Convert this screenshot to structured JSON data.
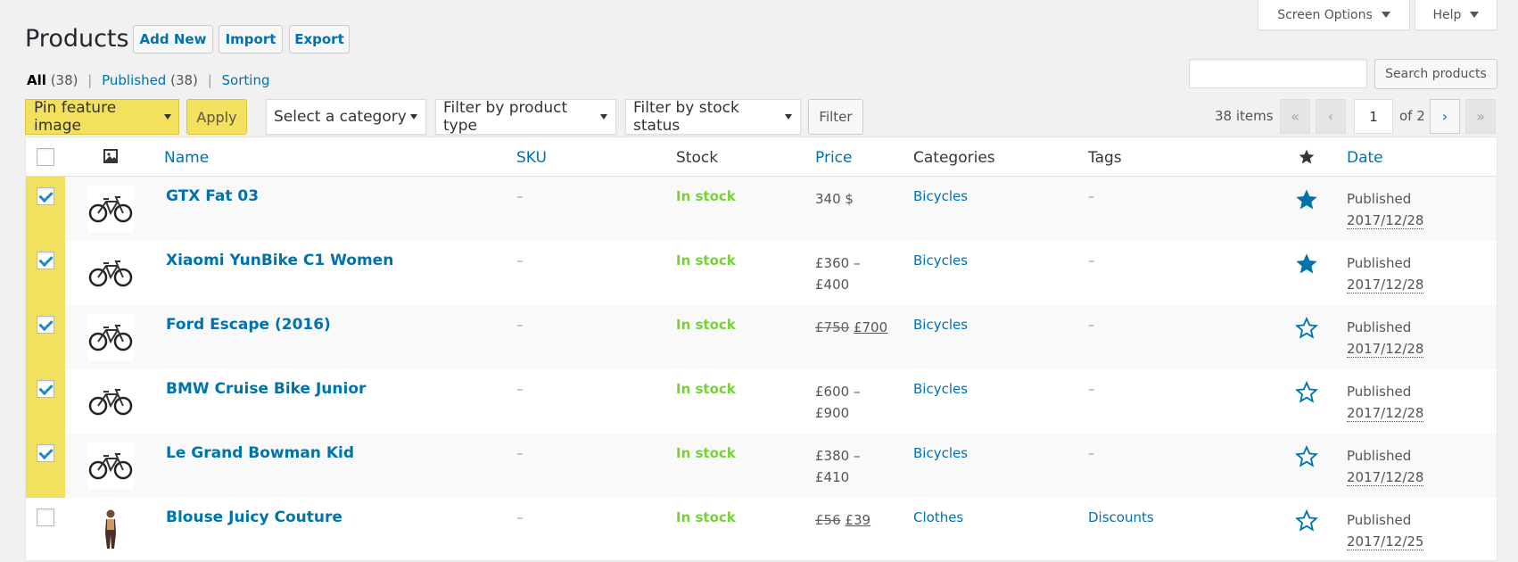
{
  "colors": {
    "accent": "#0073aa",
    "highlight": "#f3e05e",
    "in_stock": "#7ad03a",
    "background": "#f1f1f1"
  },
  "header": {
    "screen_options": "Screen Options",
    "help": "Help",
    "title": "Products",
    "add_new": "Add New",
    "import": "Import",
    "export": "Export"
  },
  "views": {
    "all_label": "All",
    "all_count": "(38)",
    "published_label": "Published",
    "published_count": "(38)",
    "sorting_label": "Sorting",
    "separator": "|"
  },
  "search": {
    "button": "Search products",
    "value": ""
  },
  "toolbar": {
    "bulk_action": "Pin feature image",
    "apply": "Apply",
    "category": "Select a category",
    "product_type": "Filter by product type",
    "stock_status": "Filter by stock status",
    "filter": "Filter"
  },
  "pagination": {
    "items": "38 items",
    "first": "«",
    "prev": "‹",
    "current": "1",
    "of": "of 2",
    "next": "›",
    "last": "»"
  },
  "table": {
    "headers": {
      "image_icon": "image-icon",
      "name": "Name",
      "sku": "SKU",
      "stock": "Stock",
      "price": "Price",
      "categories": "Categories",
      "tags": "Tags",
      "featured_icon": "star-icon",
      "date": "Date"
    },
    "rows": [
      {
        "checked": true,
        "thumb_icon": "bicycle-icon",
        "name": "GTX Fat 03",
        "sku": "–",
        "stock": "In stock",
        "price_line1": "340 $",
        "price_line2": "",
        "regular_price": "",
        "sale_price": "",
        "category": "Bicycles",
        "tags": "–",
        "featured": true,
        "date_status": "Published",
        "date": "2017/12/28"
      },
      {
        "checked": true,
        "thumb_icon": "bicycle-icon",
        "name": "Xiaomi YunBike C1 Women",
        "sku": "–",
        "stock": "In stock",
        "price_line1": "£360 –",
        "price_line2": "£400",
        "regular_price": "",
        "sale_price": "",
        "category": "Bicycles",
        "tags": "–",
        "featured": true,
        "date_status": "Published",
        "date": "2017/12/28"
      },
      {
        "checked": true,
        "thumb_icon": "bicycle-icon",
        "name": "Ford Escape (2016)",
        "sku": "–",
        "stock": "In stock",
        "price_line1": "",
        "price_line2": "",
        "regular_price": "£750",
        "sale_price": "£700",
        "category": "Bicycles",
        "tags": "–",
        "featured": false,
        "date_status": "Published",
        "date": "2017/12/28"
      },
      {
        "checked": true,
        "thumb_icon": "bicycle-icon",
        "name": "BMW Cruise Bike Junior",
        "sku": "–",
        "stock": "In stock",
        "price_line1": "£600 –",
        "price_line2": "£900",
        "regular_price": "",
        "sale_price": "",
        "category": "Bicycles",
        "tags": "–",
        "featured": false,
        "date_status": "Published",
        "date": "2017/12/28"
      },
      {
        "checked": true,
        "thumb_icon": "bicycle-icon",
        "name": "Le Grand Bowman Kid",
        "sku": "–",
        "stock": "In stock",
        "price_line1": "£380 –",
        "price_line2": "£410",
        "regular_price": "",
        "sale_price": "",
        "category": "Bicycles",
        "tags": "–",
        "featured": false,
        "date_status": "Published",
        "date": "2017/12/28"
      },
      {
        "checked": false,
        "thumb_icon": "person-icon",
        "name": "Blouse Juicy Couture",
        "sku": "–",
        "stock": "In stock",
        "price_line1": "",
        "price_line2": "",
        "regular_price": "£56",
        "sale_price": "£39",
        "category": "Clothes",
        "tags": "Discounts",
        "featured": false,
        "date_status": "Published",
        "date": "2017/12/25"
      }
    ]
  }
}
